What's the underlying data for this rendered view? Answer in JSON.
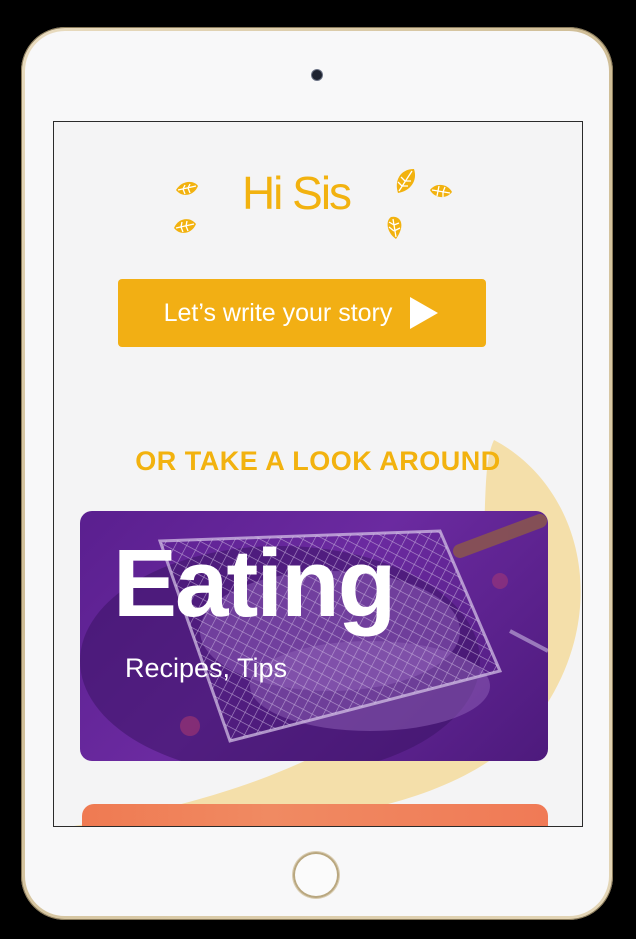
{
  "header": {
    "greeting": "Hi Sis"
  },
  "cta": {
    "label": "Let’s write your story",
    "icon": "play-icon"
  },
  "section": {
    "title": "OR TAKE A LOOK AROUND"
  },
  "cards": [
    {
      "title": "Eating",
      "subtitle": "Recipes, Tips",
      "image": "grilled-fish-photo"
    }
  ],
  "colors": {
    "accent": "#f2b20f",
    "button": "#f2af14",
    "card_purple": "#5a1f8f",
    "card_orange": "#ef7a52",
    "swoosh": "#f4dfaa"
  }
}
